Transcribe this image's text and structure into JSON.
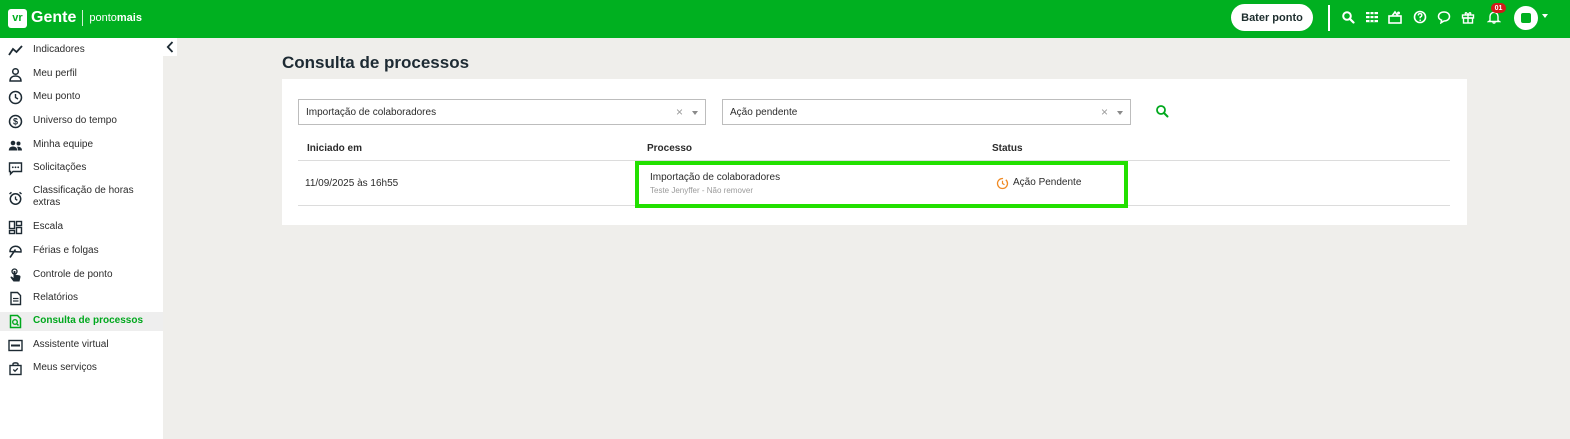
{
  "topbar": {
    "brand_logo": "vr",
    "brand_name": "Gente",
    "brand_sub_a": "ponto",
    "brand_sub_b": "mais",
    "bater_ponto": "Bater ponto",
    "notification_count": "01",
    "icons": [
      "search-icon",
      "grid-icon",
      "gift-card-icon",
      "help-icon",
      "chat-icon",
      "gift-icon",
      "bell-icon"
    ]
  },
  "sidebar": {
    "items": [
      {
        "label": "Indicadores",
        "icon": "trend-icon"
      },
      {
        "label": "Meu perfil",
        "icon": "person-icon"
      },
      {
        "label": "Meu ponto",
        "icon": "clock-icon"
      },
      {
        "label": "Universo do tempo",
        "icon": "dollar-icon"
      },
      {
        "label": "Minha equipe",
        "icon": "team-icon"
      },
      {
        "label": "Solicitações",
        "icon": "message-icon"
      },
      {
        "label": "Classificação de horas extras",
        "icon": "alarm-icon"
      },
      {
        "label": "Escala",
        "icon": "dashboard-icon"
      },
      {
        "label": "Férias e folgas",
        "icon": "umbrella-icon"
      },
      {
        "label": "Controle de ponto",
        "icon": "touch-icon"
      },
      {
        "label": "Relatórios",
        "icon": "document-icon"
      },
      {
        "label": "Consulta de processos",
        "icon": "search-doc-icon",
        "active": true
      },
      {
        "label": "Assistente virtual",
        "icon": "assistant-icon"
      },
      {
        "label": "Meus serviços",
        "icon": "bag-icon"
      }
    ]
  },
  "main": {
    "title": "Consulta de processos",
    "filters": {
      "process_type": "Importação de colaboradores",
      "status": "Ação pendente"
    },
    "table": {
      "headers": [
        "Iniciado em",
        "Processo",
        "Status"
      ],
      "rows": [
        {
          "started": "11/09/2025 às 16h55",
          "process": "Importação de colaboradores",
          "process_sub": "Teste Jenyffer - Não remover",
          "status": "Ação Pendente"
        }
      ]
    }
  },
  "colors": {
    "brand_green": "#00b020",
    "active_green": "#00a81d",
    "pending_orange": "#f08a24",
    "highlight": "#22e000"
  }
}
